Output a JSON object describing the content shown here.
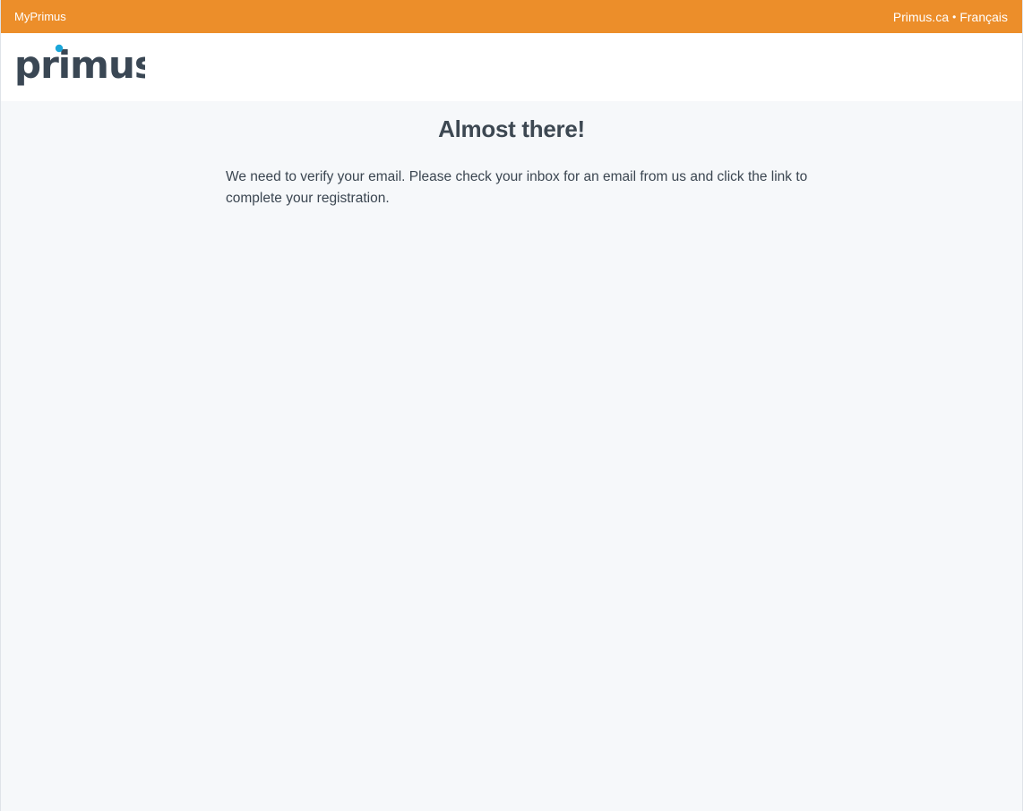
{
  "topbar": {
    "left_link": "MyPrimus",
    "right_links": [
      "Primus.ca",
      "Français"
    ],
    "separator": "•",
    "background_color": "#ec8e2a"
  },
  "header": {
    "logo": {
      "text": "primus",
      "icon": "primus-logo",
      "text_color": "#3a4754",
      "dot_color": "#1ba6d9"
    }
  },
  "main": {
    "title": "Almost there!",
    "message": "We need to verify your email. Please check your inbox for an email from us and click the link to complete your registration."
  }
}
